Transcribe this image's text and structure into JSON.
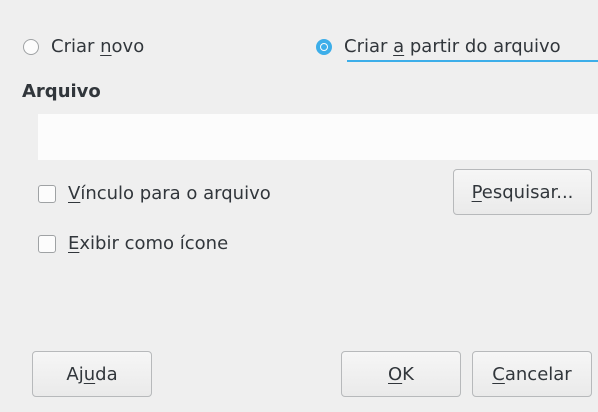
{
  "options": {
    "create_new": {
      "label": "Criar novo",
      "checked": false
    },
    "create_from_file": {
      "label": "Criar a partir do arquivo",
      "checked": true
    }
  },
  "file_section": {
    "title": "Arquivo",
    "input_value": ""
  },
  "checkboxes": {
    "link_to_file": {
      "label": "Vínculo para o arquivo",
      "checked": false
    },
    "display_as_icon": {
      "label": "Exibir como ícone",
      "checked": false
    }
  },
  "buttons": {
    "browse": "Pesquisar...",
    "help": "Ajuda",
    "ok": "OK",
    "cancel": "Cancelar"
  },
  "colors": {
    "accent": "#3daee9",
    "background": "#efefef",
    "text": "#31363b"
  }
}
